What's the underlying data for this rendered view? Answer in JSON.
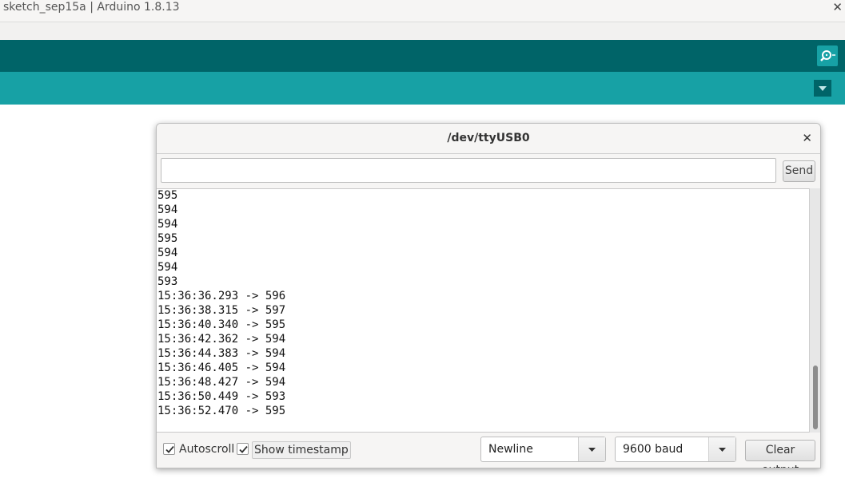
{
  "window": {
    "title": "sketch_sep15a | Arduino 1.8.13",
    "close_glyph": "✕"
  },
  "colors": {
    "toolbar": "#006468",
    "tabbar": "#17a1a5"
  },
  "toolbar": {
    "serial_monitor_icon": "magnifier-icon"
  },
  "tabbar": {
    "menu_icon": "triangle-down-icon"
  },
  "serial_monitor": {
    "title": "/dev/ttyUSB0",
    "close_glyph": "✕",
    "send_input": {
      "value": "",
      "placeholder": ""
    },
    "send_label": "Send",
    "output_lines": [
      "595",
      "594",
      "594",
      "595",
      "594",
      "594",
      "593",
      "15:36:36.293 -> 596",
      "15:36:38.315 -> 597",
      "15:36:40.340 -> 595",
      "15:36:42.362 -> 594",
      "15:36:44.383 -> 594",
      "15:36:46.405 -> 594",
      "15:36:48.427 -> 594",
      "15:36:50.449 -> 593",
      "15:36:52.470 -> 595"
    ],
    "autoscroll": {
      "label": "Autoscroll",
      "checked": true
    },
    "show_timestamp": {
      "label": "Show timestamp",
      "checked": true
    },
    "line_ending": {
      "selected": "Newline"
    },
    "baud_rate": {
      "selected": "9600 baud"
    },
    "clear_label": "Clear output"
  }
}
